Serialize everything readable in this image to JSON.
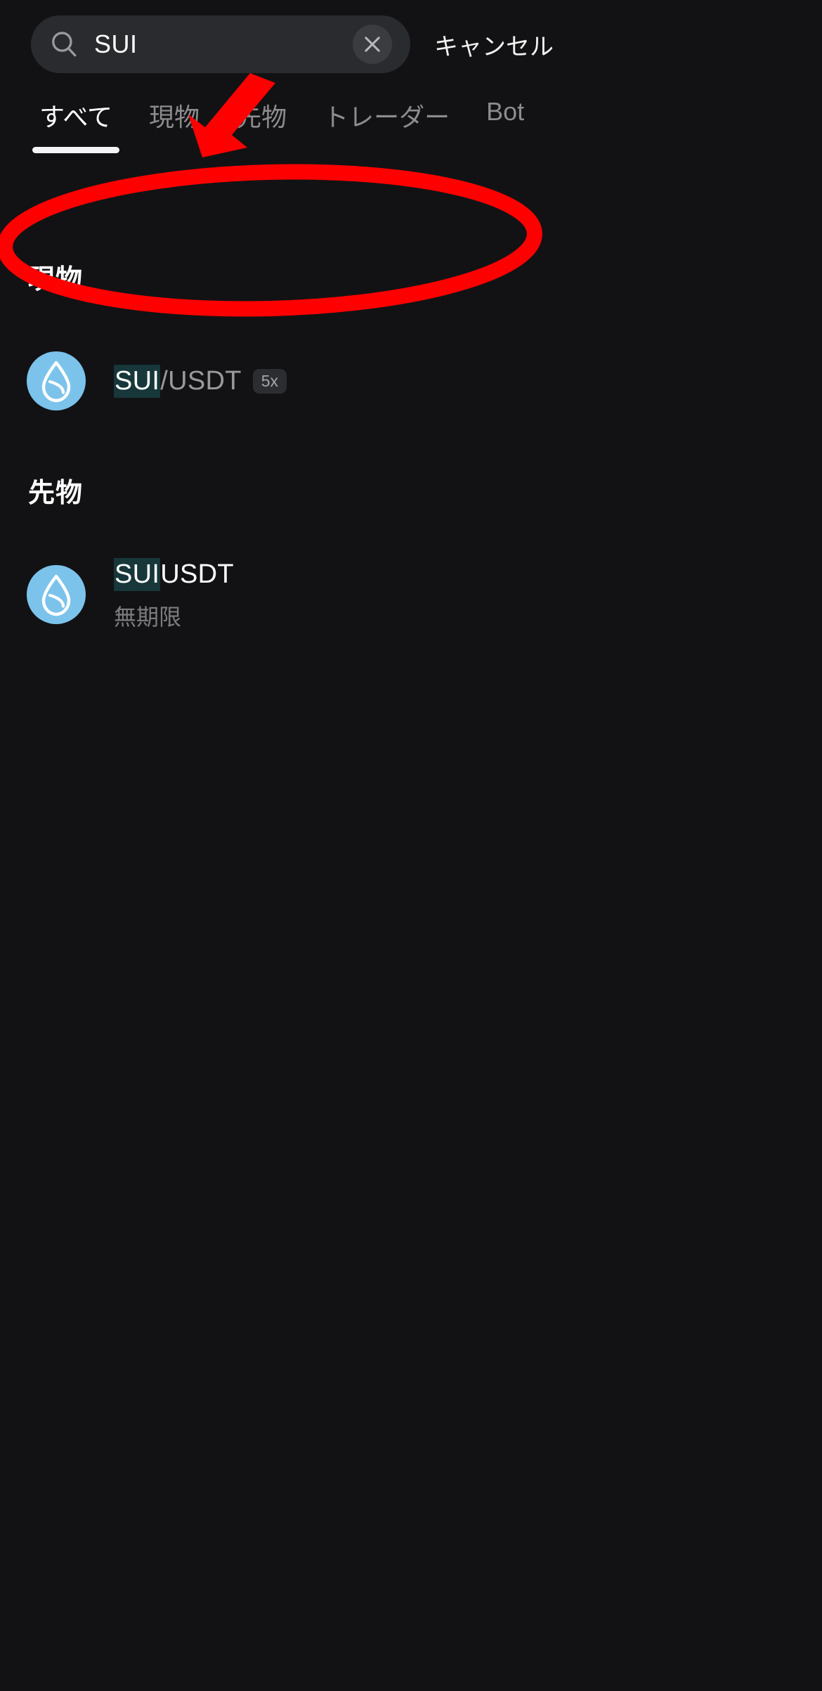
{
  "search": {
    "value": "SUI",
    "placeholder": "",
    "search_icon": "search-icon",
    "clear_icon": "close-icon",
    "cancel_label": "キャンセル"
  },
  "tabs": [
    {
      "label": "すべて",
      "active": true
    },
    {
      "label": "現物",
      "active": false
    },
    {
      "label": "先物",
      "active": false
    },
    {
      "label": "トレーダー",
      "active": false
    },
    {
      "label": "Bot",
      "active": false
    }
  ],
  "sections": [
    {
      "title": "現物",
      "rows": [
        {
          "icon": "sui-coin-icon",
          "symbol_match": "SUI",
          "symbol_rest": "/USDT",
          "symbol_rest_style": "gray",
          "badge": "5x",
          "subtitle": ""
        }
      ]
    },
    {
      "title": "先物",
      "rows": [
        {
          "icon": "sui-coin-icon",
          "symbol_match": "SUI",
          "symbol_rest": "USDT",
          "symbol_rest_style": "white",
          "badge": "",
          "subtitle": "無期限"
        }
      ]
    }
  ],
  "colors": {
    "background": "#121214",
    "search_field": "#2a2b2f",
    "match_highlight": "#17373a",
    "coin_blue": "#7cc3ec",
    "annotation_red": "#fe0000",
    "active_tab": "#ffffff",
    "inactive_tab": "#8c8c8f"
  },
  "annotations": {
    "arrow": "red-arrow-annotation",
    "ellipse": "red-ellipse-annotation"
  }
}
